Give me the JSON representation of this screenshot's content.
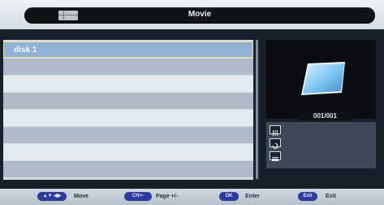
{
  "header": {
    "title": "Movie",
    "view_icon": "list-view-icon"
  },
  "file_list": {
    "items": [
      {
        "label": "disk 1",
        "selected": true
      }
    ],
    "empty_rows": 7
  },
  "preview": {
    "icon": "folder-icon"
  },
  "pagination": {
    "text": "001/001"
  },
  "info_panel": {
    "icons": [
      "columns-icon",
      "repeat-icon",
      "menu-icon"
    ]
  },
  "help_bar": {
    "items": [
      {
        "key": "▲▼ ◀▶",
        "label": "Move"
      },
      {
        "key": "CH+-",
        "label": "Page +/-"
      },
      {
        "key": "OK",
        "label": "Enter"
      },
      {
        "key": "Exit",
        "label": "Exit"
      }
    ]
  },
  "colors": {
    "background": "#18202a",
    "selected_row": "#91b1d6",
    "selected_border": "#f0df93",
    "help_button": "#2e3b9e"
  }
}
